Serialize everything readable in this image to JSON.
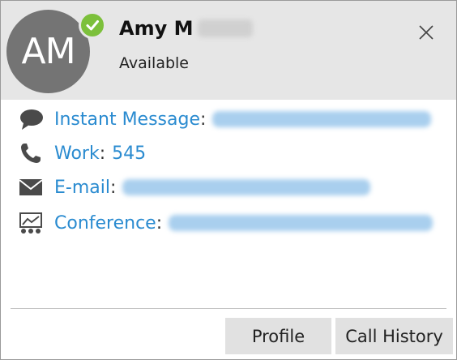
{
  "header": {
    "avatar_initials": "AM",
    "name_visible": "Amy M",
    "status": "Available",
    "presence_color": "#7cc03b",
    "presence_icon": "check-icon",
    "close_icon": "close-icon"
  },
  "contacts": [
    {
      "label": "Instant Message",
      "icon": "chat-bubble-icon",
      "value": null
    },
    {
      "label": "Work",
      "icon": "phone-icon",
      "value": "545"
    },
    {
      "label": "E-mail",
      "icon": "envelope-icon",
      "value": null
    },
    {
      "label": "Conference",
      "icon": "conference-icon",
      "value": null
    }
  ],
  "footer": {
    "profile_label": "Profile",
    "call_history_label": "Call History"
  },
  "colors": {
    "accent": "#2a8bd0",
    "header_bg": "#e6e6e6",
    "avatar_bg": "#747474",
    "button_bg": "#e1e1e1"
  }
}
